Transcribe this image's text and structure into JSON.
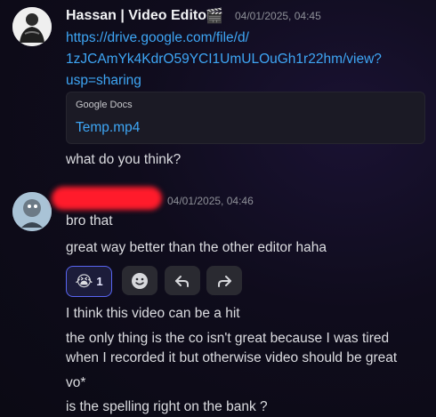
{
  "messages": [
    {
      "author": "Hassan | Video Editor",
      "author_badge": "🎬",
      "timestamp": "04/01/2025, 04:45",
      "link_lines": [
        "https://drive.google.com/file/d/",
        "1zJCAmYk4KdrO59YCI1UmULOuGh1r22hm/view?",
        "usp=sharing"
      ],
      "embed": {
        "provider": "Google Docs",
        "title": "Temp.mp4"
      },
      "text": "what do you think?"
    },
    {
      "timestamp": "04/01/2025, 04:46",
      "lines": [
        "bro that",
        "great way better than the other editor haha"
      ],
      "reactions": [
        {
          "emoji": "😭",
          "count": "1"
        }
      ],
      "followups": [
        "I think this video can be a hit",
        "the only thing is the co isn't great because I was tired",
        "when I recorded it but otherwise video should be great",
        "vo*",
        "is the spelling right on the bank ?"
      ]
    }
  ],
  "colors": {
    "link": "#3ea6f5",
    "reaction_border": "#5865f2",
    "redaction": "#ff1b2b"
  },
  "icons": [
    "smiley-icon",
    "reply-icon",
    "forward-icon"
  ]
}
